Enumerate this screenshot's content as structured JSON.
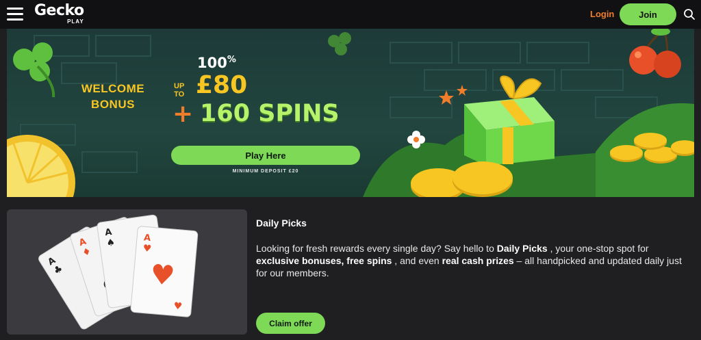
{
  "header": {
    "logo_main": "Gecko",
    "logo_sub": "PLAY",
    "login_label": "Login",
    "join_label": "Join",
    "icons": {
      "menu": "menu-icon",
      "search": "search-icon"
    }
  },
  "banner": {
    "welcome_line1": "WELCOME",
    "welcome_line2": "BONUS",
    "percent": "100",
    "percent_sign": "%",
    "up": "UP",
    "to": "TO",
    "amount": "£80",
    "plus": "+",
    "spins": "160 SPINS",
    "cta_label": "Play Here",
    "min_deposit": "MINIMUM DEPOSIT £20"
  },
  "promo": {
    "title": "Daily Picks",
    "desc_1": "Looking for fresh rewards every single day? Say hello to ",
    "desc_2": "Daily Picks",
    "desc_3": " , your one-stop spot for ",
    "desc_4": "exclusive bonuses, free spins",
    "desc_5": " , and even ",
    "desc_6": "real cash prizes",
    "desc_7": " – all handpicked and updated daily just for our members.",
    "cta_label": "Claim offer"
  },
  "colors": {
    "accent_green": "#7ed957",
    "login_orange": "#f07d2a",
    "gold": "#f7c623",
    "page_bg": "#1f1f21",
    "header_bg": "#111113"
  }
}
